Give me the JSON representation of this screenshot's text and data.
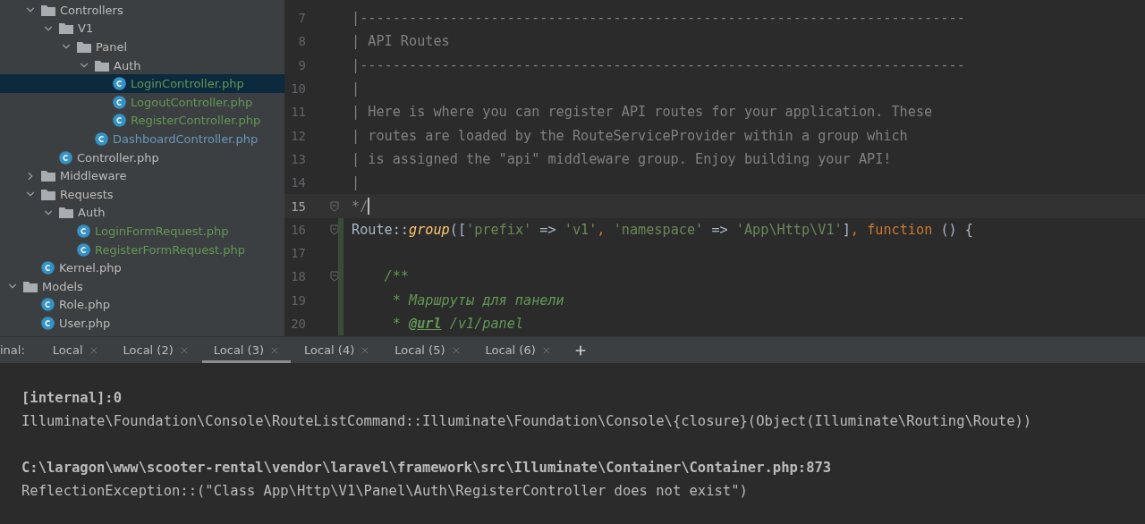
{
  "project_tree": [
    {
      "children": [
        {
          "label": "Controllers",
          "kind": "folder",
          "expanded": true,
          "children": [
            {
              "label": "V1",
              "kind": "folder",
              "expanded": true,
              "children": [
                {
                  "label": "Panel",
                  "kind": "folder",
                  "expanded": true,
                  "children": [
                    {
                      "label": "Auth",
                      "kind": "folder",
                      "expanded": true,
                      "children": [
                        {
                          "label": "LoginController.php",
                          "kind": "class",
                          "color": "#629755",
                          "selected": true
                        },
                        {
                          "label": "LogoutController.php",
                          "kind": "class",
                          "color": "#629755",
                          "selected": false
                        },
                        {
                          "label": "RegisterController.php",
                          "kind": "class",
                          "color": "#629755",
                          "selected": false
                        }
                      ]
                    },
                    {
                      "label": "DashboardController.php",
                      "kind": "class",
                      "color": "#6897bb",
                      "selected": false
                    }
                  ]
                }
              ]
            },
            {
              "label": "Controller.php",
              "kind": "class",
              "color": "#bbbbbb",
              "selected": false
            }
          ]
        },
        {
          "label": "Middleware",
          "kind": "folder",
          "expanded": false
        },
        {
          "label": "Requests",
          "kind": "folder",
          "expanded": true,
          "children": [
            {
              "label": "Auth",
              "kind": "folder",
              "expanded": true,
              "children": [
                {
                  "label": "LoginFormRequest.php",
                  "kind": "class",
                  "color": "#629755",
                  "selected": false
                },
                {
                  "label": "RegisterFormRequest.php",
                  "kind": "class",
                  "color": "#629755",
                  "selected": false
                }
              ]
            }
          ]
        },
        {
          "label": "Kernel.php",
          "kind": "class",
          "color": "#bbbbbb",
          "selected": false
        }
      ]
    },
    {
      "label": "Models",
      "kind": "folder",
      "expanded": true,
      "children": [
        {
          "label": "Role.php",
          "kind": "class",
          "color": "#bbbbbb",
          "selected": false
        },
        {
          "label": "User.php",
          "kind": "class",
          "color": "#bbbbbb",
          "selected": false
        }
      ]
    }
  ],
  "editor": {
    "lines": [
      {
        "number": "7",
        "current": false,
        "fold": false,
        "changed": false,
        "tokens": [
          {
            "kind": "comment",
            "text": "|--------------------------------------------------------------------------"
          }
        ]
      },
      {
        "number": "8",
        "current": false,
        "fold": false,
        "changed": false,
        "tokens": [
          {
            "kind": "comment",
            "text": "| API Routes"
          }
        ]
      },
      {
        "number": "9",
        "current": false,
        "fold": false,
        "changed": false,
        "tokens": [
          {
            "kind": "comment",
            "text": "|--------------------------------------------------------------------------"
          }
        ]
      },
      {
        "number": "10",
        "current": false,
        "fold": false,
        "changed": false,
        "tokens": [
          {
            "kind": "comment",
            "text": "|"
          }
        ]
      },
      {
        "number": "11",
        "current": false,
        "fold": false,
        "changed": false,
        "tokens": [
          {
            "kind": "comment",
            "text": "| Here is where you can register API routes for your application. These"
          }
        ]
      },
      {
        "number": "12",
        "current": false,
        "fold": false,
        "changed": false,
        "tokens": [
          {
            "kind": "comment",
            "text": "| routes are loaded by the RouteServiceProvider within a group which"
          }
        ]
      },
      {
        "number": "13",
        "current": false,
        "fold": false,
        "changed": false,
        "tokens": [
          {
            "kind": "comment",
            "text": "| is assigned the \"api\" middleware group. Enjoy building your API!"
          }
        ]
      },
      {
        "number": "14",
        "current": false,
        "fold": false,
        "changed": false,
        "tokens": [
          {
            "kind": "comment",
            "text": "|"
          }
        ]
      },
      {
        "number": "15",
        "current": true,
        "fold": true,
        "changed": false,
        "tokens": [
          {
            "kind": "comment",
            "text": "*/"
          }
        ]
      },
      {
        "number": "16",
        "current": false,
        "fold": true,
        "changed": true,
        "tokens": [
          {
            "kind": "plain",
            "text": "Route::"
          },
          {
            "kind": "method",
            "text": "group"
          },
          {
            "kind": "plain",
            "text": "(["
          },
          {
            "kind": "string",
            "text": "'prefix'"
          },
          {
            "kind": "plain",
            "text": " => "
          },
          {
            "kind": "string",
            "text": "'v1'"
          },
          {
            "kind": "keyword",
            "text": ", "
          },
          {
            "kind": "string",
            "text": "'namespace'"
          },
          {
            "kind": "plain",
            "text": " => "
          },
          {
            "kind": "string",
            "text": "'App\\Http\\V1'"
          },
          {
            "kind": "plain",
            "text": "]"
          },
          {
            "kind": "keyword",
            "text": ", function "
          },
          {
            "kind": "plain",
            "text": "() {"
          }
        ]
      },
      {
        "number": "17",
        "current": false,
        "fold": false,
        "changed": true
      },
      {
        "number": "18",
        "current": false,
        "fold": true,
        "changed": true,
        "tokens": [
          {
            "kind": "doc",
            "text": "    /**"
          }
        ]
      },
      {
        "number": "19",
        "current": false,
        "fold": false,
        "changed": true,
        "tokens": [
          {
            "kind": "doc",
            "text": "     * Маршруты для панели"
          }
        ]
      },
      {
        "number": "20",
        "current": false,
        "fold": false,
        "changed": true,
        "tokens": [
          {
            "kind": "doc",
            "text": "     * "
          },
          {
            "kind": "doctag",
            "text": "@url"
          },
          {
            "kind": "doc",
            "text": " /v1/panel"
          }
        ]
      }
    ]
  },
  "terminal": {
    "label": "inal:",
    "tabs": [
      {
        "label": "Local",
        "selected": false
      },
      {
        "label": "Local (2)",
        "selected": false
      },
      {
        "label": "Local (3)",
        "selected": true
      },
      {
        "label": "Local (4)",
        "selected": false
      },
      {
        "label": "Local (5)",
        "selected": false
      },
      {
        "label": "Local (6)",
        "selected": false
      }
    ],
    "output": [
      {
        "kind": "bold",
        "text": "[internal]:0"
      },
      {
        "kind": "plain",
        "text": "Illuminate\\Foundation\\Console\\RouteListCommand::Illuminate\\Foundation\\Console\\{closure}(Object(Illuminate\\Routing\\Route))"
      },
      {
        "kind": "blank"
      },
      {
        "kind": "bold",
        "text": "C:\\laragon\\www\\scooter-rental\\vendor\\laravel\\framework\\src\\Illuminate\\Container\\Container.php:873"
      },
      {
        "kind": "plain",
        "text": "ReflectionException::(\"Class App\\Http\\V1\\Panel\\Auth\\RegisterController does not exist\")"
      }
    ]
  }
}
